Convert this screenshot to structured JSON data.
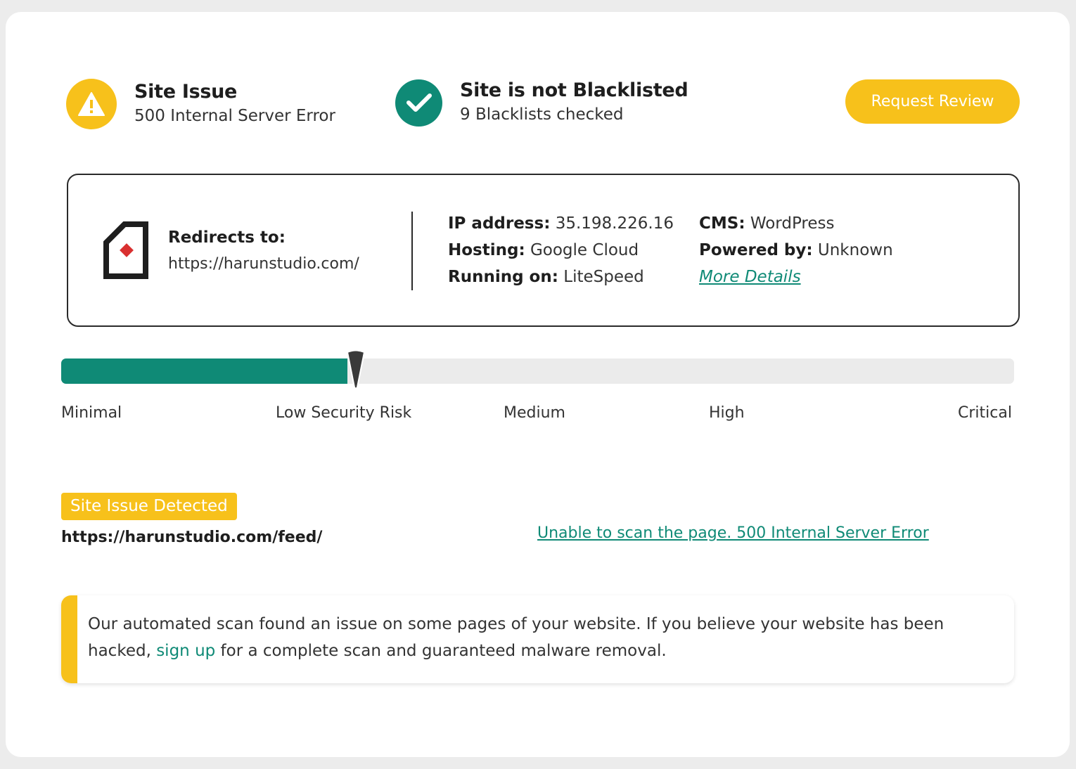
{
  "colors": {
    "accent_yellow": "#f7c11b",
    "accent_green": "#0f8a76",
    "track_gray": "#ebebeb"
  },
  "status_issue": {
    "icon": "warning-icon",
    "title": "Site Issue",
    "subtitle": "500 Internal Server Error"
  },
  "status_blacklist": {
    "icon": "check-icon",
    "title": "Site is not Blacklisted",
    "subtitle": "9 Blacklists checked"
  },
  "request_review_label": "Request Review",
  "redirect": {
    "icon": "redirect-file-icon",
    "label": "Redirects to:",
    "url": "https://harunstudio.com/"
  },
  "server_info": {
    "ip_label": "IP address:",
    "ip_value": "35.198.226.16",
    "hosting_label": "Hosting:",
    "hosting_value": "Google Cloud",
    "running_label": "Running on:",
    "running_value": "LiteSpeed"
  },
  "cms_info": {
    "cms_label": "CMS:",
    "cms_value": "WordPress",
    "powered_label": "Powered by:",
    "powered_value": "Unknown",
    "more_details": "More Details"
  },
  "risk_meter": {
    "level_fraction": 0.3,
    "labels": [
      "Minimal",
      "Low Security Risk",
      "Medium",
      "High",
      "Critical"
    ]
  },
  "issue": {
    "badge": "Site Issue Detected",
    "url": "https://harunstudio.com/feed/",
    "message": "Unable to scan the page. 500 Internal Server Error"
  },
  "notice": {
    "text_before": "Our automated scan found an issue on some pages of your website. If you believe your website has been hacked, ",
    "link": "sign up",
    "text_after": " for a complete scan and guaranteed malware removal."
  }
}
